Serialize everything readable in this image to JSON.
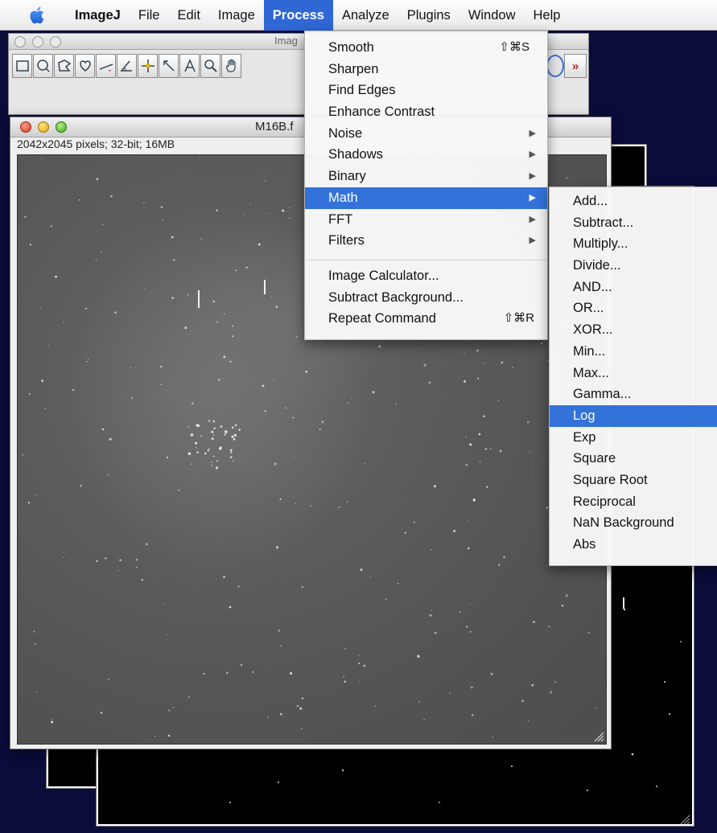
{
  "menubar": {
    "app": "ImageJ",
    "items": [
      "File",
      "Edit",
      "Image",
      "Process",
      "Analyze",
      "Plugins",
      "Window",
      "Help"
    ],
    "active": "Process"
  },
  "toolbar_window": {
    "title": "Imag",
    "tool_icons": [
      "rectangle-tool-icon",
      "oval-tool-icon",
      "polygon-tool-icon",
      "freehand-tool-icon",
      "line-tool-icon",
      "angle-tool-icon",
      "point-tool-icon",
      "wand-tool-icon",
      "text-tool-icon",
      "magnifier-tool-icon",
      "hand-tool-icon"
    ],
    "more_label": "»"
  },
  "image_window": {
    "title": "M16B.f",
    "info": "2042x2045 pixels; 32-bit; 16MB"
  },
  "process_menu": {
    "items": [
      {
        "label": "Smooth",
        "shortcut": "⇧⌘S",
        "submenu": false
      },
      {
        "label": "Sharpen",
        "shortcut": "",
        "submenu": false
      },
      {
        "label": "Find Edges",
        "shortcut": "",
        "submenu": false
      },
      {
        "label": "Enhance Contrast",
        "shortcut": "",
        "submenu": false
      },
      {
        "label": "Noise",
        "shortcut": "",
        "submenu": true
      },
      {
        "label": "Shadows",
        "shortcut": "",
        "submenu": true
      },
      {
        "label": "Binary",
        "shortcut": "",
        "submenu": true
      },
      {
        "label": "Math",
        "shortcut": "",
        "submenu": true
      },
      {
        "label": "FFT",
        "shortcut": "",
        "submenu": true
      },
      {
        "label": "Filters",
        "shortcut": "",
        "submenu": true
      }
    ],
    "items_after_separator": [
      {
        "label": "Image Calculator...",
        "shortcut": ""
      },
      {
        "label": "Subtract Background...",
        "shortcut": ""
      },
      {
        "label": "Repeat Command",
        "shortcut": "⇧⌘R"
      }
    ],
    "highlighted": "Math"
  },
  "math_submenu": {
    "items": [
      "Add...",
      "Subtract...",
      "Multiply...",
      "Divide...",
      "AND...",
      "OR...",
      "XOR...",
      "Min...",
      "Max...",
      "Gamma...",
      "Log",
      "Exp",
      "Square",
      "Square Root",
      "Reciprocal",
      "NaN Background",
      "Abs"
    ],
    "highlighted": "Log"
  },
  "colors": {
    "desktop": "#0a0c3a",
    "menu_highlight": "#3372d9",
    "menubar_active": "#2f67d4"
  }
}
